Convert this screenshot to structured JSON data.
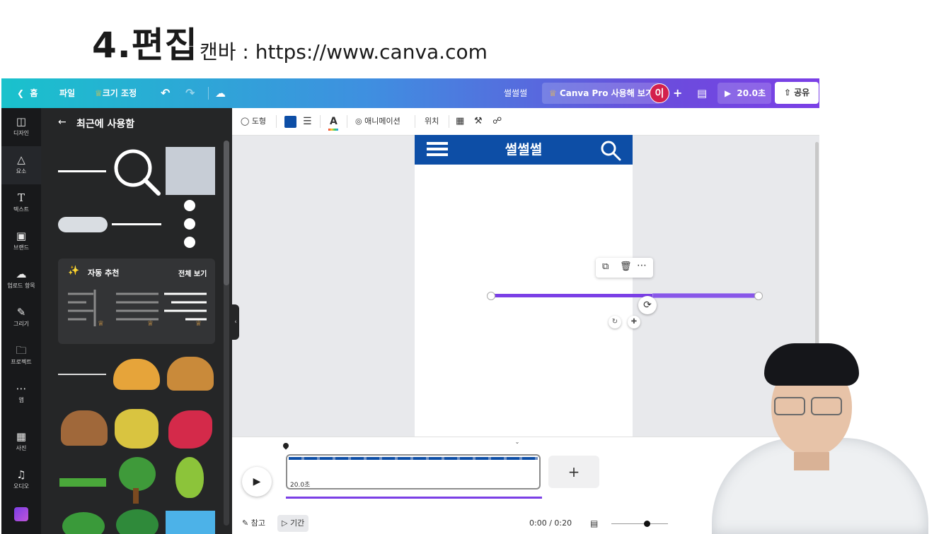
{
  "slide": {
    "title": "4.편집",
    "subtitle": "캔바 : https://www.canva.com"
  },
  "topbar": {
    "home": "홈",
    "file": "파일",
    "resize": "크기 조정",
    "doc_title": "썰썰썰",
    "pro": "Canva Pro 사용해 보기",
    "avatar": "이",
    "present": "20.0초",
    "share": "공유"
  },
  "rail": {
    "items": [
      "디자인",
      "요소",
      "텍스트",
      "브랜드",
      "업로드 항목",
      "그리기",
      "프로젝트",
      "앱",
      "사진",
      "오디오"
    ]
  },
  "panel": {
    "title": "최근에 사용함",
    "auto_title": "자동 추천",
    "see_all": "전체 보기"
  },
  "toolbar": {
    "shape": "도형",
    "shape_color": "#0d4ea6",
    "animation": "애니메이션",
    "position": "위치"
  },
  "page": {
    "header_title": "썰썰썰",
    "header_color": "#0d4ea6",
    "line_color": "#7b3fe6"
  },
  "timeline": {
    "clip_duration": "20.0초",
    "notes": "참고",
    "duration": "기간",
    "time": "0:00 / 0:20",
    "add": "+"
  },
  "colors": {
    "accent": "#7b3fe6",
    "brand_blue": "#0d4ea6"
  }
}
